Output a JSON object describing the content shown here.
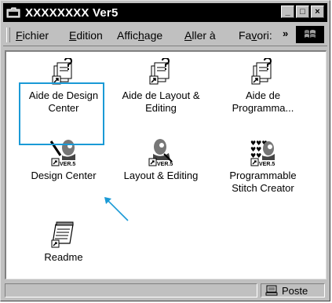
{
  "window": {
    "title": "XXXXXXXX Ver5",
    "minimize": "_",
    "maximize": "□",
    "close": "×"
  },
  "menu": {
    "items": [
      {
        "pre": "",
        "u": "F",
        "post": "ichier"
      },
      {
        "pre": "",
        "u": "E",
        "post": "dition"
      },
      {
        "pre": "Affic",
        "u": "h",
        "post": "age"
      },
      {
        "pre": "",
        "u": "A",
        "post": "ller à"
      },
      {
        "pre": "Fa",
        "u": "v",
        "post": "ori:"
      }
    ],
    "more": "»"
  },
  "icons": [
    {
      "label": "Aide de Design\nCenter",
      "icon": "help-file-icon"
    },
    {
      "label": "Aide de Layout &\nEditing",
      "icon": "help-file-icon"
    },
    {
      "label": "Aide de\nProgramma...",
      "icon": "help-file-icon"
    },
    {
      "label": "Design Center",
      "icon": "design-center-app-icon"
    },
    {
      "label": "Layout & Editing",
      "icon": "layout-editing-app-icon"
    },
    {
      "label": "Programmable\nStitch Creator",
      "icon": "stitch-creator-app-icon"
    },
    {
      "label": "Readme",
      "icon": "readme-notepad-icon"
    }
  ],
  "statusbar": {
    "location": "Poste"
  },
  "colors": {
    "selection": "#1a9ad6",
    "titlebar": "#000000",
    "chrome": "#c0c0c0"
  }
}
